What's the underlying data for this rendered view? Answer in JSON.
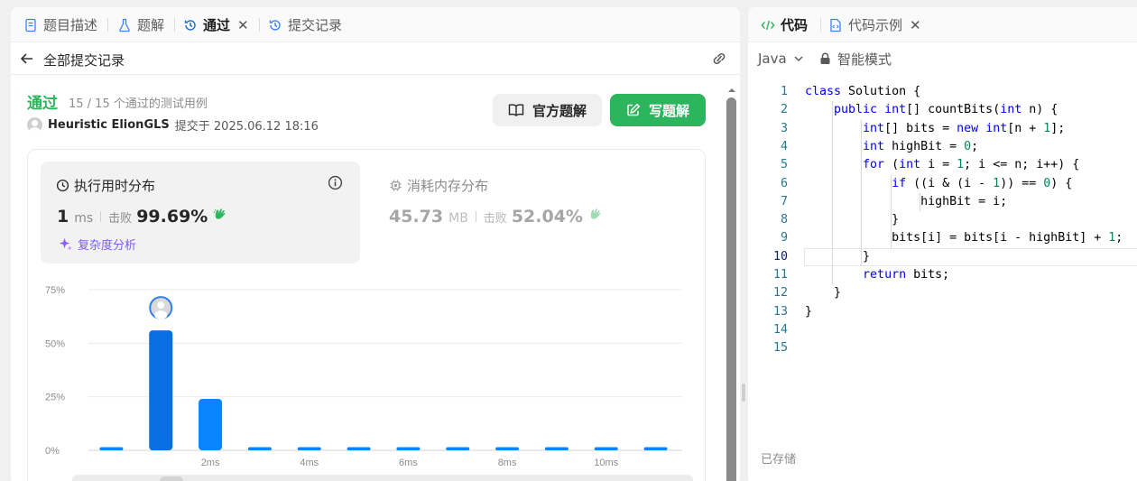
{
  "tabs": {
    "description": "题目描述",
    "solutions": "题解",
    "accepted": "通过",
    "submissions": "提交记录",
    "close_glyph": "✕"
  },
  "subheader": {
    "title": "全部提交记录"
  },
  "result": {
    "status": "通过",
    "testcases": "15 / 15 个通过的测试用例",
    "author": "Heuristic ElionGLS",
    "submitted_at": "提交于 2025.06.12 18:16"
  },
  "buttons": {
    "official": "官方题解",
    "write": "写题解"
  },
  "runtime": {
    "title": "执行用时分布",
    "value": "1",
    "unit": "ms",
    "beat_label": "击败",
    "beat_value": "99.69%",
    "analysis": "复杂度分析"
  },
  "memory": {
    "title": "消耗内存分布",
    "value": "45.73",
    "unit": "MB",
    "beat_label": "击败",
    "beat_value": "52.04%"
  },
  "colors": {
    "accent_green": "#2db55d",
    "bar_blue": "#0a84ff",
    "bar_dark": "#0a6fe0",
    "purple": "#7b5cf0"
  },
  "chart_data": {
    "type": "bar",
    "ylim": [
      0,
      75
    ],
    "yticks": [
      "0%",
      "25%",
      "50%",
      "75%"
    ],
    "ytick_values": [
      0,
      25,
      50,
      75
    ],
    "x_labels": [
      "",
      "",
      "2ms",
      "",
      "4ms",
      "",
      "6ms",
      "",
      "8ms",
      "",
      "10ms",
      ""
    ],
    "values": [
      1.5,
      56,
      24,
      1.5,
      1.5,
      1.5,
      1.5,
      1.5,
      1.5,
      1.5,
      1.5,
      1.5
    ],
    "highlight_index": 1,
    "grid": true
  },
  "code_panel": {
    "tab_code": "代码",
    "tab_example": "代码示例",
    "close_glyph": "✕",
    "language": "Java",
    "mode": "智能模式",
    "saved": "已存储",
    "active_line": 10,
    "lines": [
      {
        "n": "1",
        "t": "class Solution {"
      },
      {
        "n": "2",
        "t": "    public int[] countBits(int n) {"
      },
      {
        "n": "3",
        "t": "        int[] bits = new int[n + 1];"
      },
      {
        "n": "4",
        "t": "        int highBit = 0;"
      },
      {
        "n": "5",
        "t": "        for (int i = 1; i <= n; i++) {"
      },
      {
        "n": "6",
        "t": "            if ((i & (i - 1)) == 0) {"
      },
      {
        "n": "7",
        "t": "                highBit = i;"
      },
      {
        "n": "8",
        "t": "            }"
      },
      {
        "n": "9",
        "t": "            bits[i] = bits[i - highBit] + 1;"
      },
      {
        "n": "10",
        "t": "        }"
      },
      {
        "n": "11",
        "t": "        return bits;"
      },
      {
        "n": "12",
        "t": "    }"
      },
      {
        "n": "13",
        "t": "}"
      },
      {
        "n": "14",
        "t": ""
      },
      {
        "n": "15",
        "t": ""
      }
    ]
  }
}
